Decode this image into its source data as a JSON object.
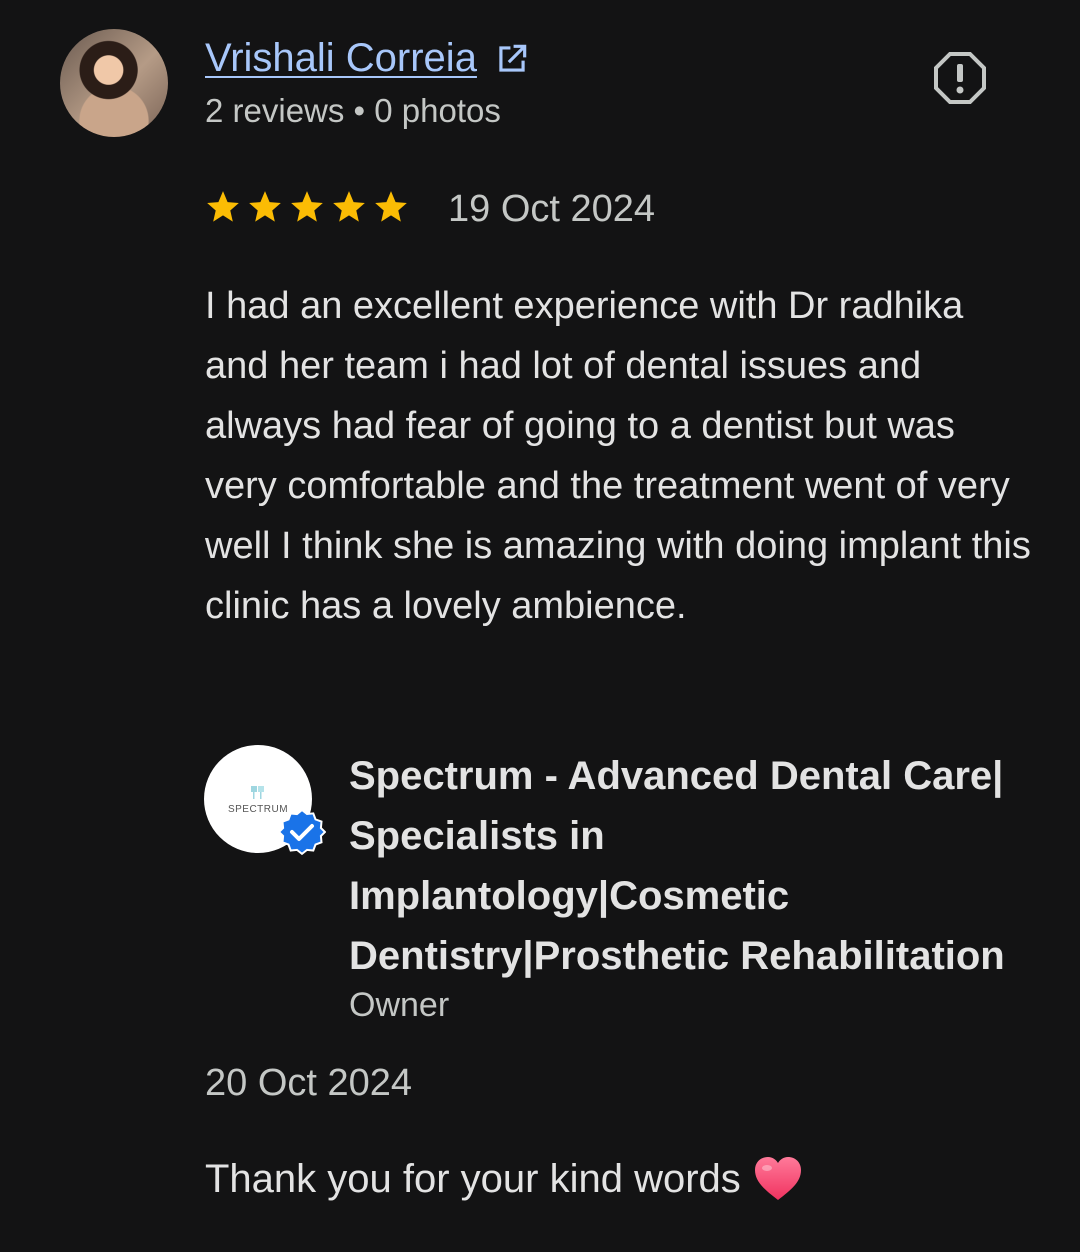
{
  "review": {
    "reviewer_name": "Vrishali Correia",
    "reviewer_meta": "2 reviews • 0 photos",
    "rating": 5,
    "rating_max": 5,
    "date": "19 Oct 2024",
    "text": "I had an excellent experience with Dr radhika and her team i had lot of dental issues and always had fear of going to a dentist but was very comfortable and the treatment went of very well I think she is amazing with doing implant this clinic has a lovely ambience.",
    "icons": {
      "avatar": "reviewer-avatar",
      "external_link": "external-link-icon",
      "report": "report-icon",
      "star": "star-icon"
    }
  },
  "owner_reply": {
    "logo_text": "SPECTRUM",
    "business_name": "Spectrum - Advanced Dental Care| Specialists in Implantology|Cosmetic Dentistry|Prosthetic Rehabilitation",
    "role": "Owner",
    "date": "20 Oct 2024",
    "text": "Thank you for your kind words",
    "icons": {
      "verified": "verified-badge-icon",
      "heart": "heart-icon"
    }
  },
  "colors": {
    "background": "#131314",
    "link": "#a8c7fa",
    "star": "#fbbc04",
    "verified": "#1a73e8",
    "heart": "#ff4f7a"
  }
}
